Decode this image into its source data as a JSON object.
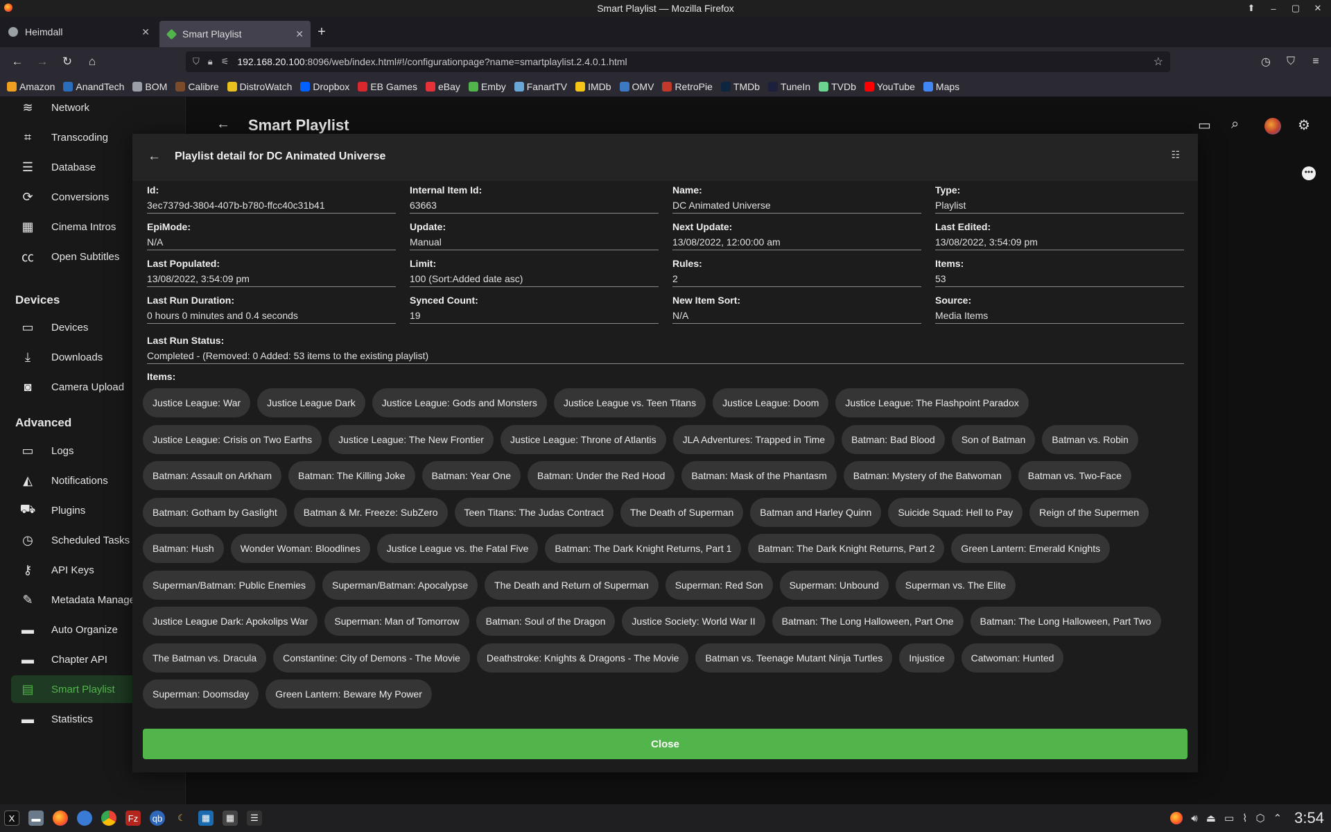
{
  "window": {
    "title": "Smart Playlist — Mozilla Firefox"
  },
  "tabs": [
    {
      "label": "Heimdall",
      "color": "#9aa0a6"
    },
    {
      "label": "Smart Playlist",
      "color": "#52b54b"
    }
  ],
  "url": {
    "host": "192.168.20.100",
    "rest": ":8096/web/index.html#!/configurationpage?name=smartplaylist.2.4.0.1.html"
  },
  "bookmarks": [
    {
      "label": "Amazon",
      "color": "#f0a020"
    },
    {
      "label": "AnandTech",
      "color": "#2a6ebb"
    },
    {
      "label": "BOM",
      "color": "#9aa0a6"
    },
    {
      "label": "Calibre",
      "color": "#7b4b2a"
    },
    {
      "label": "DistroWatch",
      "color": "#e8c020"
    },
    {
      "label": "Dropbox",
      "color": "#0061fe"
    },
    {
      "label": "EB Games",
      "color": "#d9272e"
    },
    {
      "label": "eBay",
      "color": "#e53238"
    },
    {
      "label": "Emby",
      "color": "#52b54b"
    },
    {
      "label": "FanartTV",
      "color": "#6aa6d6"
    },
    {
      "label": "IMDb",
      "color": "#f5c518"
    },
    {
      "label": "OMV",
      "color": "#3c79c2"
    },
    {
      "label": "RetroPie",
      "color": "#c0392b"
    },
    {
      "label": "TMDb",
      "color": "#0d253f"
    },
    {
      "label": "TuneIn",
      "color": "#1c203c"
    },
    {
      "label": "TVDb",
      "color": "#6cd491"
    },
    {
      "label": "YouTube",
      "color": "#ff0000"
    },
    {
      "label": "Maps",
      "color": "#4285f4"
    }
  ],
  "sidebar": {
    "items_top": [
      {
        "label": "Network",
        "icon": "wifi-icon",
        "glyph": "≋"
      },
      {
        "label": "Transcoding",
        "icon": "crop-icon",
        "glyph": "⌗"
      },
      {
        "label": "Database",
        "icon": "database-icon",
        "glyph": "☰"
      },
      {
        "label": "Conversions",
        "icon": "sync-icon",
        "glyph": "⟳"
      },
      {
        "label": "Cinema Intros",
        "icon": "film-icon",
        "glyph": "▦"
      },
      {
        "label": "Open Subtitles",
        "icon": "cc-icon",
        "glyph": "㏄"
      }
    ],
    "devices_heading": "Devices",
    "items_devices": [
      {
        "label": "Devices",
        "icon": "devices-icon",
        "glyph": "▭"
      },
      {
        "label": "Downloads",
        "icon": "download-icon",
        "glyph": "⤓"
      },
      {
        "label": "Camera Upload",
        "icon": "camera-icon",
        "glyph": "◙"
      }
    ],
    "advanced_heading": "Advanced",
    "items_advanced": [
      {
        "label": "Logs",
        "icon": "folder-icon",
        "glyph": "▭"
      },
      {
        "label": "Notifications",
        "icon": "bell-icon",
        "glyph": "◭"
      },
      {
        "label": "Plugins",
        "icon": "cart-icon",
        "glyph": "⛟"
      },
      {
        "label": "Scheduled Tasks",
        "icon": "clock-icon",
        "glyph": "◷"
      },
      {
        "label": "API Keys",
        "icon": "key-icon",
        "glyph": "⚷"
      },
      {
        "label": "Metadata Manager",
        "icon": "pencil-icon",
        "glyph": "✎"
      },
      {
        "label": "Auto Organize",
        "icon": "folder-icon",
        "glyph": "▬"
      },
      {
        "label": "Chapter API",
        "icon": "folder-icon",
        "glyph": "▬"
      },
      {
        "label": "Smart Playlist",
        "icon": "playlist-icon",
        "glyph": "▤"
      },
      {
        "label": "Statistics",
        "icon": "folder-icon",
        "glyph": "▬"
      }
    ]
  },
  "page": {
    "title": "Smart Playlist"
  },
  "dialog": {
    "title": "Playlist detail for DC Animated Universe",
    "fields": [
      {
        "label": "Id:",
        "value": "3ec7379d-3804-407b-b780-ffcc40c31b41"
      },
      {
        "label": "Internal Item Id:",
        "value": "63663"
      },
      {
        "label": "Name:",
        "value": "DC Animated Universe"
      },
      {
        "label": "Type:",
        "value": "Playlist"
      },
      {
        "label": "EpiMode:",
        "value": "N/A"
      },
      {
        "label": "Update:",
        "value": "Manual"
      },
      {
        "label": "Next Update:",
        "value": "13/08/2022, 12:00:00 am"
      },
      {
        "label": "Last Edited:",
        "value": "13/08/2022, 3:54:09 pm"
      },
      {
        "label": "Last Populated:",
        "value": "13/08/2022, 3:54:09 pm"
      },
      {
        "label": "Limit:",
        "value": "100 (Sort:Added date asc)"
      },
      {
        "label": "Rules:",
        "value": "2"
      },
      {
        "label": "Items:",
        "value": "53"
      },
      {
        "label": "Last Run Duration:",
        "value": "0 hours 0 minutes and 0.4 seconds"
      },
      {
        "label": "Synced Count:",
        "value": "19"
      },
      {
        "label": "New Item Sort:",
        "value": "N/A"
      },
      {
        "label": "Source:",
        "value": "Media Items"
      }
    ],
    "status": {
      "label": "Last Run Status:",
      "value": "Completed - (Removed: 0 Added: 53 items to the existing playlist)"
    },
    "items_label": "Items:",
    "item_rows": [
      [
        "Justice League: War",
        "Justice League Dark",
        "Justice League: Gods and Monsters",
        "Justice League vs. Teen Titans",
        "Justice League: Doom",
        "Justice League: The Flashpoint Paradox"
      ],
      [
        "Justice League: Crisis on Two Earths",
        "Justice League: The New Frontier",
        "Justice League: Throne of Atlantis",
        "JLA Adventures: Trapped in Time",
        "Batman: Bad Blood",
        "Son of Batman",
        "Batman vs. Robin"
      ],
      [
        "Batman: Assault on Arkham",
        "Batman: The Killing Joke",
        "Batman: Year One",
        "Batman: Under the Red Hood",
        "Batman: Mask of the Phantasm",
        "Batman: Mystery of the Batwoman",
        "Batman vs. Two-Face"
      ],
      [
        "Batman: Gotham by Gaslight",
        "Batman & Mr. Freeze: SubZero",
        "Teen Titans: The Judas Contract",
        "The Death of Superman",
        "Batman and Harley Quinn",
        "Suicide Squad: Hell to Pay",
        "Reign of the Supermen"
      ],
      [
        "Batman: Hush",
        "Wonder Woman: Bloodlines",
        "Justice League vs. the Fatal Five",
        "Batman: The Dark Knight Returns, Part 1",
        "Batman: The Dark Knight Returns, Part 2",
        "Green Lantern: Emerald Knights"
      ],
      [
        "Superman/Batman: Public Enemies",
        "Superman/Batman: Apocalypse",
        "The Death and Return of Superman",
        "Superman: Red Son",
        "Superman: Unbound",
        "Superman vs. The Elite"
      ],
      [
        "Justice League Dark: Apokolips War",
        "Superman: Man of Tomorrow",
        "Batman: Soul of the Dragon",
        "Justice Society: World War II",
        "Batman: The Long Halloween, Part One",
        "Batman: The Long Halloween, Part Two"
      ],
      [
        "The Batman vs. Dracula",
        "Constantine: City of Demons - The Movie",
        "Deathstroke: Knights & Dragons - The Movie",
        "Batman vs. Teenage Mutant Ninja Turtles",
        "Injustice",
        "Catwoman: Hunted"
      ],
      [
        "Superman: Doomsday",
        "Green Lantern: Beware My Power"
      ]
    ],
    "close_label": "Close"
  },
  "taskbar": {
    "clock": "3:54"
  },
  "colors": {
    "accent": "#52b54b"
  }
}
